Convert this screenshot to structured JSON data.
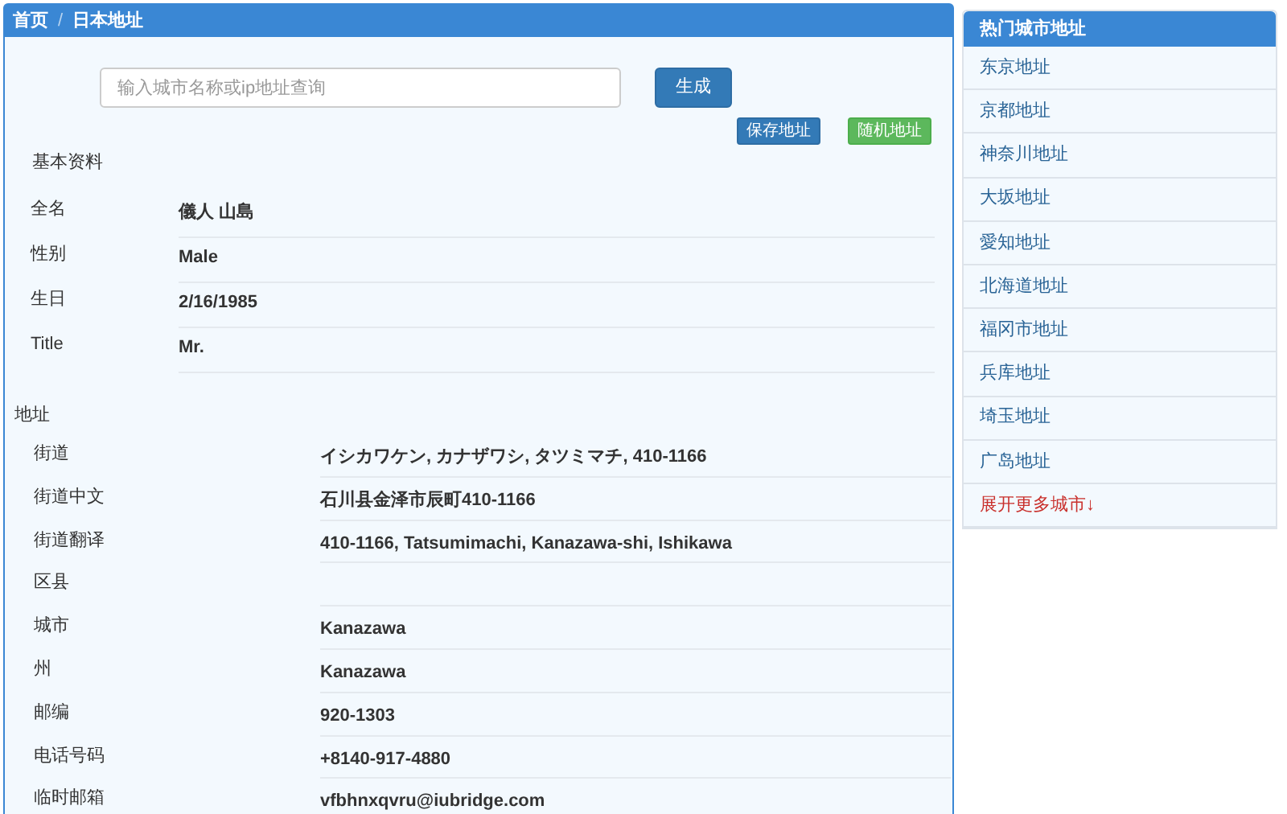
{
  "breadcrumb": {
    "items": [
      "首页",
      "日本地址"
    ],
    "separator": "/"
  },
  "search": {
    "placeholder": "输入城市名称或ip地址查询",
    "button": "生成"
  },
  "actions": [
    {
      "label": "保存地址",
      "kind": "primary"
    },
    {
      "label": "随机地址",
      "kind": "success"
    }
  ],
  "basic_info": {
    "title": "基本资料",
    "rows": [
      {
        "label": "全名",
        "value": "儀人 山島"
      },
      {
        "label": "性别",
        "value": "Male"
      },
      {
        "label": "生日",
        "value": "2/16/1985"
      },
      {
        "label": "Title",
        "value": "Mr."
      }
    ]
  },
  "address": {
    "title": "地址",
    "rows": [
      {
        "label": "街道",
        "value": "イシカワケン, カナザワシ, タツミマチ, 410-1166"
      },
      {
        "label": "街道中文",
        "value": "石川县金泽市辰町410-1166"
      },
      {
        "label": "街道翻译",
        "value": "410-1166, Tatsumimachi, Kanazawa-shi, Ishikawa"
      },
      {
        "label": "区县"
      },
      {
        "label": "城市",
        "value": "Kanazawa"
      },
      {
        "label": "州",
        "value": "Kanazawa"
      },
      {
        "label": "邮编",
        "value": "920-1303"
      },
      {
        "label": "电话号码",
        "value": "+8140-917-4880"
      },
      {
        "label": "临时邮箱",
        "value": "vfbhnxqvru@iubridge.com"
      }
    ]
  },
  "sidebar": {
    "title": "热门城市地址",
    "items": [
      {
        "label": "东京地址",
        "kind": "city"
      },
      {
        "label": "京都地址",
        "kind": "city"
      },
      {
        "label": "神奈川地址",
        "kind": "city"
      },
      {
        "label": "大坂地址",
        "kind": "city"
      },
      {
        "label": "愛知地址",
        "kind": "city"
      },
      {
        "label": "北海道地址",
        "kind": "city"
      },
      {
        "label": "福冈市地址",
        "kind": "city"
      },
      {
        "label": "兵库地址",
        "kind": "city"
      },
      {
        "label": "埼玉地址",
        "kind": "city"
      },
      {
        "label": "广岛地址",
        "kind": "city"
      },
      {
        "label": "展开更多城市↓",
        "kind": "more"
      }
    ]
  }
}
